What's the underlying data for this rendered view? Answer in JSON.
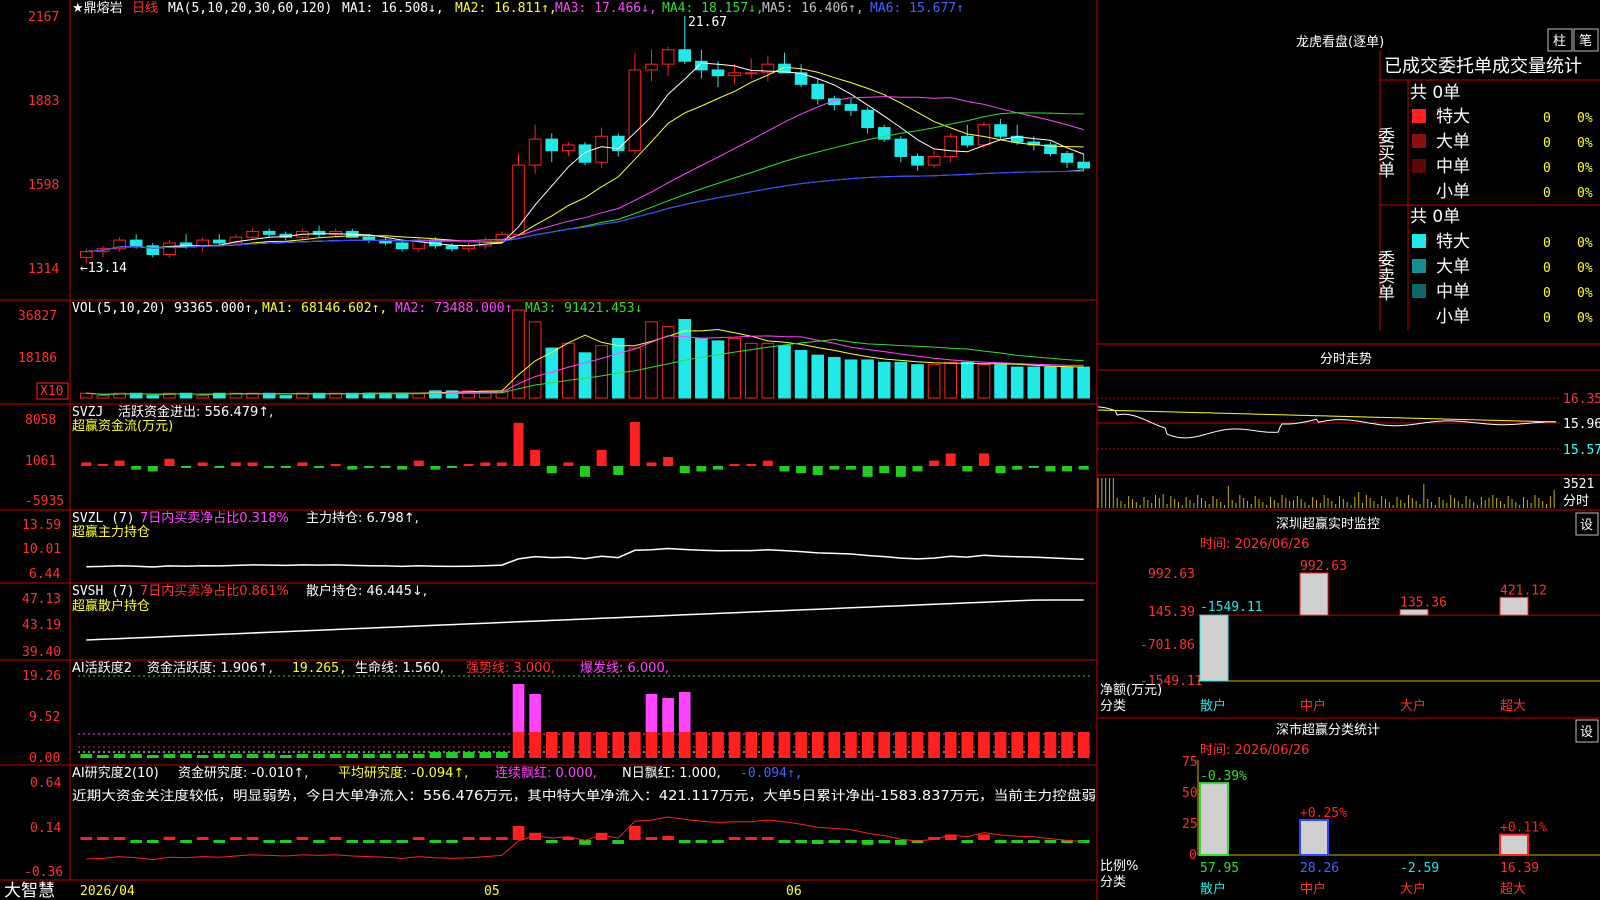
{
  "colors": {
    "up": "#ff2020",
    "down": "#22e8e8",
    "grid": "#c00000",
    "bg": "#000000",
    "ma1": "#ffffff",
    "ma2": "#ffff33",
    "ma3": "#ff44ff",
    "ma4": "#33dd33",
    "ma5": "#c0c0c0",
    "ma6": "#3344ff"
  },
  "header": {
    "symbol": "★鼎熔岩",
    "period": "日线",
    "ma_label": "MA(5,10,20,30,60,120)",
    "ma1": "MA1: 16.508↓,",
    "ma2": "MA2: 16.811↑,",
    "ma3": "MA3: 17.466↓,",
    "ma4": "MA4: 18.157↓,",
    "ma5": "MA5: 16.406↑,",
    "ma6": "MA6: 15.677↑"
  },
  "price_axis": [
    "2167",
    "1883",
    "1598",
    "1314"
  ],
  "annotations": {
    "high": "21.67",
    "low": "←13.14"
  },
  "vol_panel": {
    "title": "VOL(5,10,20)",
    "value": "93365.000↑,",
    "ma1": "MA1: 68146.602↑,",
    "ma2": "MA2: 73488.000↑,",
    "ma3": "MA3: 91421.453↓",
    "axis": [
      "36827",
      "18186"
    ],
    "unit": "X10"
  },
  "svzj_panel": {
    "title": "SVZJ",
    "label": "活跃资金进出: 556.479↑,",
    "sub": "超赢资金流(万元)",
    "axis": [
      "8058",
      "1061",
      "-5935"
    ]
  },
  "svzl_panel": {
    "title": "SVZL (7)",
    "label1": "7日内买卖净占比0.318%",
    "label2": "主力持仓: 6.798↑,",
    "sub": "超赢主力持仓",
    "axis": [
      "13.59",
      "10.01",
      "6.44"
    ]
  },
  "svsh_panel": {
    "title": "SVSH (7)",
    "label1": "7日内买卖净占比0.861%",
    "label2": "散户持仓: 46.445↓,",
    "sub": "超赢散户持仓",
    "axis": [
      "47.13",
      "43.19",
      "39.40"
    ]
  },
  "ai1_panel": {
    "title": "AI活跃度2",
    "label1": "资金活跃度: 1.906↑,",
    "label2": "19.265,",
    "label3": "生命线: 1.560,",
    "label4": "强势线: 3.000,",
    "label5": "爆发线: 6.000,",
    "axis": [
      "19.26",
      "9.52",
      "0.00"
    ]
  },
  "ai2_panel": {
    "title": "AI研究度2(10)",
    "label1": "资金研究度: -0.010↑,",
    "label2": "平均研究度: -0.094↑,",
    "label3": "连续飘红: 0.000,",
    "label4": "N日飘红: 1.000,",
    "label5": "-0.094↑,",
    "comment": "近期大资金关注度较低，明显弱势，今日大单净流入：556.476万元，其中特大单净流入：421.117万元，大单5日累计净出-1583.837万元，当前主力控盘弱",
    "axis": [
      "0.64",
      "0.14",
      "-0.36"
    ]
  },
  "date_axis": {
    "brand": "大智慧",
    "d1": "2026/04",
    "d2": "05",
    "d3": "06"
  },
  "right": {
    "lh_title": "龙虎看盘(逐单)",
    "btn_zhu": "柱",
    "btn_bi": "笔",
    "tabs": [
      "已成交",
      "委托单",
      "成交量",
      "统计"
    ],
    "buy_side": "委买单",
    "sell_side": "委卖单",
    "buy_total": "共 0单",
    "sell_total": "共 0单",
    "buy_rows": [
      {
        "name": "特大",
        "count": "0",
        "pct": "0%",
        "color": "#ff2020"
      },
      {
        "name": "大单",
        "count": "0",
        "pct": "0%",
        "color": "#8a1010"
      },
      {
        "name": "中单",
        "count": "0",
        "pct": "0%",
        "color": "#5a0808"
      },
      {
        "name": "小单",
        "count": "0",
        "pct": "0%",
        "color": "#000000"
      }
    ],
    "sell_rows": [
      {
        "name": "特大",
        "count": "0",
        "pct": "0%",
        "color": "#22e8e8"
      },
      {
        "name": "大单",
        "count": "0",
        "pct": "0%",
        "color": "#109090"
      },
      {
        "name": "中单",
        "count": "0",
        "pct": "0%",
        "color": "#0a6868"
      },
      {
        "name": "小单",
        "count": "0",
        "pct": "0%",
        "color": "#000000"
      }
    ],
    "intraday_title": "分时走势",
    "intraday_axis": [
      "16.35",
      "15.96",
      "15.57"
    ],
    "intraday_vol": "3521",
    "intraday_vol_unit": "分时",
    "monitor_title": "深圳超赢实时监控",
    "monitor_btn": "设",
    "monitor_time": "时间: 2026/06/26",
    "monitor_axis": [
      "992.63",
      "145.39",
      "-701.86",
      "-1549.11"
    ],
    "monitor_ylabel": "净额(万元)",
    "monitor_xlabel": "分类",
    "monitor_bars": [
      {
        "cat": "散户",
        "value": -1549.11,
        "label": "-1549.11",
        "color": "#22e8e8"
      },
      {
        "cat": "中户",
        "value": 992.63,
        "label": "992.63",
        "color": "#ff2020"
      },
      {
        "cat": "大户",
        "value": 135.36,
        "label": "135.36",
        "color": "#ff2020"
      },
      {
        "cat": "超大",
        "value": 421.12,
        "label": "421.12",
        "color": "#ff2020"
      }
    ],
    "class_title": "深市超赢分类统计",
    "class_btn": "设",
    "class_time": "时间: 2026/06/26",
    "class_axis": [
      "75",
      "50",
      "25",
      "0"
    ],
    "class_ylabel": "比例%",
    "class_xlabel": "分类",
    "class_bars": [
      {
        "cat": "散户",
        "value": 57.95,
        "label": "57.95",
        "delta": "-0.39%",
        "color": "#33dd33",
        "dcolor": "#33dd33"
      },
      {
        "cat": "中户",
        "value": 28.26,
        "label": "28.26",
        "delta": "+0.25%",
        "color": "#3344ff",
        "dcolor": "#ff2020"
      },
      {
        "cat": "大户",
        "value": -2.59,
        "label": "-2.59",
        "delta": "",
        "color": "#22e8e8",
        "dcolor": "#22e8e8"
      },
      {
        "cat": "超大",
        "value": 16.39,
        "label": "16.39",
        "delta": "+0.11%",
        "color": "#ff2020",
        "dcolor": "#ff2020"
      }
    ]
  },
  "chart_data": {
    "type": "candlestick",
    "title": "鼎熔岩 日线",
    "ylim": [
      13.14,
      21.67
    ],
    "candles": [
      [
        13.3,
        13.6,
        13.1,
        13.5
      ],
      [
        13.5,
        13.7,
        13.3,
        13.6
      ],
      [
        13.6,
        14.0,
        13.5,
        13.9
      ],
      [
        13.9,
        14.1,
        13.6,
        13.7
      ],
      [
        13.7,
        13.8,
        13.3,
        13.4
      ],
      [
        13.4,
        13.9,
        13.3,
        13.8
      ],
      [
        13.8,
        14.1,
        13.6,
        13.7
      ],
      [
        13.7,
        14.0,
        13.5,
        13.9
      ],
      [
        13.9,
        14.1,
        13.7,
        13.8
      ],
      [
        13.8,
        14.1,
        13.7,
        14.0
      ],
      [
        14.0,
        14.3,
        13.9,
        14.2
      ],
      [
        14.2,
        14.3,
        14.0,
        14.1
      ],
      [
        14.1,
        14.2,
        13.9,
        14.0
      ],
      [
        14.0,
        14.3,
        13.9,
        14.2
      ],
      [
        14.2,
        14.4,
        14.0,
        14.1
      ],
      [
        14.1,
        14.3,
        14.0,
        14.2
      ],
      [
        14.2,
        14.3,
        14.0,
        14.0
      ],
      [
        14.0,
        14.1,
        13.8,
        13.9
      ],
      [
        13.9,
        14.0,
        13.7,
        13.8
      ],
      [
        13.8,
        13.9,
        13.5,
        13.6
      ],
      [
        13.6,
        14.0,
        13.5,
        13.9
      ],
      [
        13.9,
        14.0,
        13.6,
        13.7
      ],
      [
        13.7,
        13.8,
        13.5,
        13.6
      ],
      [
        13.6,
        13.8,
        13.5,
        13.7
      ],
      [
        13.7,
        14.0,
        13.6,
        13.9
      ],
      [
        13.9,
        14.2,
        13.8,
        14.1
      ],
      [
        14.1,
        16.9,
        14.1,
        16.5
      ],
      [
        16.5,
        17.9,
        16.2,
        17.4
      ],
      [
        17.4,
        17.6,
        16.6,
        17.0
      ],
      [
        17.0,
        17.3,
        16.8,
        17.2
      ],
      [
        17.2,
        17.3,
        16.5,
        16.6
      ],
      [
        16.6,
        17.8,
        16.4,
        17.5
      ],
      [
        17.5,
        17.6,
        16.8,
        17.0
      ],
      [
        17.0,
        20.4,
        16.9,
        19.8
      ],
      [
        19.8,
        20.5,
        19.4,
        20.0
      ],
      [
        20.0,
        20.6,
        19.6,
        20.5
      ],
      [
        20.5,
        21.67,
        20.0,
        20.1
      ],
      [
        20.1,
        20.5,
        19.5,
        19.8
      ],
      [
        19.8,
        20.1,
        19.2,
        19.6
      ],
      [
        19.6,
        20.0,
        19.3,
        19.7
      ],
      [
        19.7,
        20.2,
        19.5,
        19.7
      ],
      [
        19.7,
        20.3,
        19.4,
        20.0
      ],
      [
        20.0,
        20.4,
        19.7,
        19.7
      ],
      [
        19.7,
        20.0,
        19.2,
        19.3
      ],
      [
        19.3,
        19.5,
        18.6,
        18.8
      ],
      [
        18.8,
        18.9,
        18.4,
        18.6
      ],
      [
        18.6,
        18.8,
        18.2,
        18.4
      ],
      [
        18.4,
        18.5,
        17.6,
        17.8
      ],
      [
        17.8,
        17.9,
        17.3,
        17.4
      ],
      [
        17.4,
        17.5,
        16.6,
        16.8
      ],
      [
        16.8,
        16.9,
        16.3,
        16.5
      ],
      [
        16.5,
        17.0,
        16.4,
        16.8
      ],
      [
        16.8,
        17.6,
        16.6,
        17.5
      ],
      [
        17.5,
        17.9,
        17.1,
        17.2
      ],
      [
        17.2,
        18.0,
        17.1,
        17.9
      ],
      [
        17.9,
        18.1,
        17.4,
        17.5
      ],
      [
        17.5,
        17.9,
        17.2,
        17.3
      ],
      [
        17.3,
        17.5,
        17.0,
        17.2
      ],
      [
        17.2,
        17.3,
        16.8,
        16.9
      ],
      [
        16.9,
        17.0,
        16.4,
        16.6
      ],
      [
        16.6,
        16.9,
        16.3,
        16.4
      ]
    ],
    "vol_values": [
      2,
      1,
      2,
      2,
      1,
      2,
      2,
      1,
      2,
      2,
      2,
      2,
      1,
      2,
      2,
      2,
      2,
      2,
      2,
      2,
      2,
      3,
      3,
      3,
      3,
      3,
      37,
      32,
      21,
      23,
      19,
      22,
      25,
      21,
      32,
      30,
      33,
      25,
      24,
      25,
      23,
      23,
      22,
      20,
      18,
      17,
      16,
      16,
      15,
      15,
      14,
      14,
      15,
      15,
      14,
      14,
      13,
      13,
      13,
      13,
      13
    ]
  }
}
